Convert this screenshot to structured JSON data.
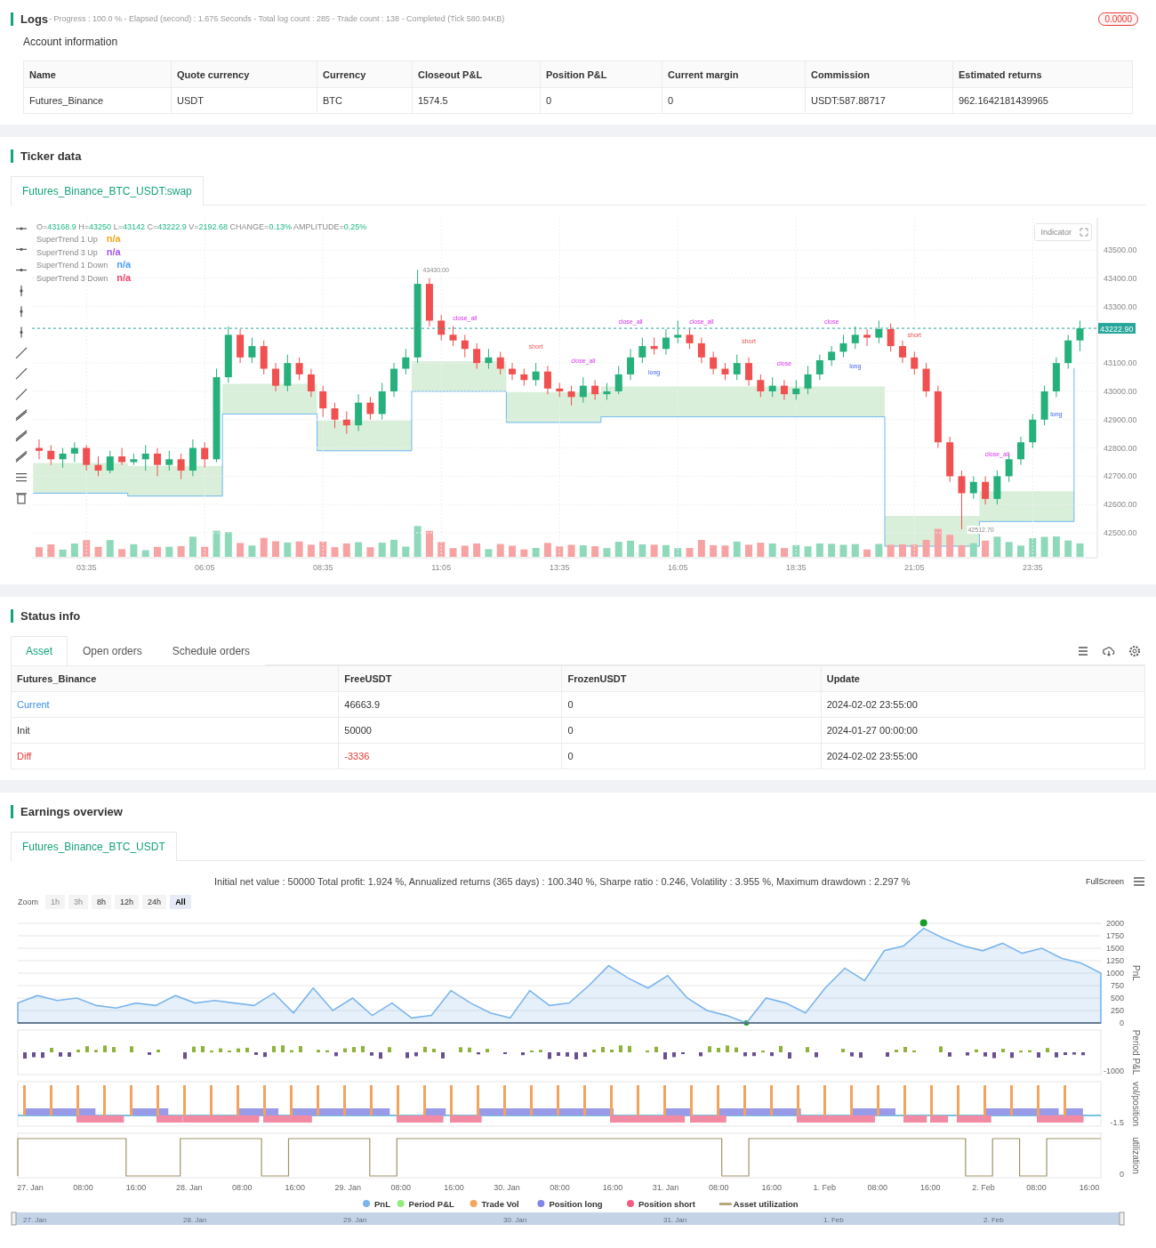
{
  "logs": {
    "title": "Logs",
    "summary": "- Progress : 100.0 % - Elapsed (second) : 1.676  Seconds - Total log count : 285 - Trade count : 138 - Completed (Tick 580.94KB)",
    "badge": "0.0000"
  },
  "account": {
    "title": "Account information",
    "columns": [
      "Name",
      "Quote currency",
      "Currency",
      "Closeout P&L",
      "Position P&L",
      "Current margin",
      "Commission",
      "Estimated returns"
    ],
    "rows": [
      [
        "Futures_Binance",
        "USDT",
        "BTC",
        "1574.5",
        "0",
        "0",
        "USDT:587.88717",
        "962.1642181439965"
      ]
    ]
  },
  "ticker": {
    "title": "Ticker data",
    "tabs": [
      {
        "label": "Futures_Binance_BTC_USDT:swap",
        "selected": true
      }
    ],
    "chart": {
      "ohlc": [
        {
          "label": "O=",
          "value": "43168.9"
        },
        {
          "label": "H=",
          "value": "43250"
        },
        {
          "label": "L=",
          "value": "43142"
        },
        {
          "label": "C=",
          "value": "43222.9"
        },
        {
          "label": "V=",
          "value": "2192.68"
        },
        {
          "label": "CHANGE=",
          "value": "0.13%"
        },
        {
          "label": "AMPLITUDE=",
          "value": "0.25%"
        }
      ],
      "legend": [
        {
          "name": "SuperTrend 1 Up",
          "value": "n/a",
          "color": "#f5a623"
        },
        {
          "name": "SuperTrend 3 Up",
          "value": "n/a",
          "color": "#a259e6"
        },
        {
          "name": "SuperTrend 1 Down",
          "value": "n/a",
          "color": "#4a9ff5"
        },
        {
          "name": "SuperTrend 3 Down",
          "value": "n/a",
          "color": "#f0436a"
        }
      ],
      "indicator_button": "Indicator",
      "current_price": "43222.90",
      "high_label": "43430.00",
      "low_label": "42512.70",
      "markers": [
        {
          "text": "close_all",
          "kind": "close"
        },
        {
          "text": "short",
          "kind": "short"
        },
        {
          "text": "close_all",
          "kind": "close"
        },
        {
          "text": "close_all",
          "kind": "close"
        },
        {
          "text": "long",
          "kind": "long"
        },
        {
          "text": "close_all",
          "kind": "close"
        },
        {
          "text": "short",
          "kind": "short"
        },
        {
          "text": "close",
          "kind": "close"
        },
        {
          "text": "close",
          "kind": "close"
        },
        {
          "text": "long",
          "kind": "long"
        },
        {
          "text": "short",
          "kind": "short"
        },
        {
          "text": "close_all",
          "kind": "close"
        },
        {
          "text": "long",
          "kind": "long"
        }
      ],
      "chart_data": {
        "type": "candlestick",
        "grid": true,
        "ylim": [
          42412,
          43613
        ],
        "yticks": [
          {
            "value": 43500,
            "label": "43500.00"
          },
          {
            "value": 43400,
            "label": "43400.00"
          },
          {
            "value": 43300,
            "label": "43300.00"
          },
          {
            "value": 43100,
            "label": "43100.00"
          },
          {
            "value": 43000,
            "label": "43000.00"
          },
          {
            "value": 42900,
            "label": "42900.00"
          },
          {
            "value": 42800,
            "label": "42800.00"
          },
          {
            "value": 42700,
            "label": "42700.00"
          },
          {
            "value": 42600,
            "label": "42600.00"
          },
          {
            "value": 42500,
            "label": "42500.00"
          }
        ],
        "xlim": [
          146,
          1497
        ],
        "xticks": [
          {
            "value": 215,
            "label": "03:35"
          },
          {
            "value": 365,
            "label": "06:05"
          },
          {
            "value": 515,
            "label": "08:35"
          },
          {
            "value": 665,
            "label": "11:05"
          },
          {
            "value": 815,
            "label": "13:35"
          },
          {
            "value": 965,
            "label": "16:05"
          },
          {
            "value": 1115,
            "label": "18:35"
          },
          {
            "value": 1265,
            "label": "21:05"
          },
          {
            "value": 1415,
            "label": "23:35"
          }
        ],
        "x": [
          155,
          170,
          185,
          200,
          215,
          230,
          245,
          260,
          275,
          290,
          305,
          320,
          335,
          350,
          365,
          380,
          395,
          410,
          425,
          440,
          455,
          470,
          485,
          500,
          515,
          530,
          545,
          560,
          575,
          590,
          605,
          620,
          635,
          650,
          665,
          680,
          695,
          710,
          725,
          740,
          755,
          770,
          785,
          800,
          815,
          830,
          845,
          860,
          875,
          890,
          905,
          920,
          935,
          950,
          965,
          980,
          995,
          1010,
          1025,
          1040,
          1055,
          1070,
          1085,
          1100,
          1115,
          1130,
          1145,
          1160,
          1175,
          1190,
          1205,
          1220,
          1235,
          1250,
          1265,
          1280,
          1295,
          1310,
          1325,
          1340,
          1355,
          1370,
          1385,
          1400,
          1415,
          1430,
          1445,
          1460,
          1475
        ],
        "ohlc": [
          [
            42800,
            42830,
            42760,
            42790
          ],
          [
            42790,
            42810,
            42740,
            42760
          ],
          [
            42760,
            42800,
            42730,
            42780
          ],
          [
            42780,
            42820,
            42750,
            42800
          ],
          [
            42800,
            42810,
            42720,
            42740
          ],
          [
            42740,
            42770,
            42700,
            42720
          ],
          [
            42720,
            42790,
            42710,
            42770
          ],
          [
            42770,
            42800,
            42740,
            42750
          ],
          [
            42750,
            42780,
            42740,
            42760
          ],
          [
            42760,
            42810,
            42720,
            42780
          ],
          [
            42780,
            42800,
            42700,
            42740
          ],
          [
            42740,
            42790,
            42720,
            42760
          ],
          [
            42760,
            42780,
            42690,
            42720
          ],
          [
            42720,
            42830,
            42700,
            42800
          ],
          [
            42800,
            42820,
            42730,
            42760
          ],
          [
            42760,
            43080,
            42750,
            43050
          ],
          [
            43050,
            43230,
            43030,
            43200
          ],
          [
            43200,
            43220,
            43100,
            43120
          ],
          [
            43120,
            43190,
            43100,
            43160
          ],
          [
            43160,
            43180,
            43060,
            43080
          ],
          [
            43080,
            43100,
            43000,
            43020
          ],
          [
            43020,
            43130,
            43000,
            43100
          ],
          [
            43100,
            43120,
            43040,
            43060
          ],
          [
            43060,
            43080,
            42980,
            43000
          ],
          [
            43000,
            43020,
            42910,
            42940
          ],
          [
            42940,
            42960,
            42870,
            42900
          ],
          [
            42900,
            42930,
            42850,
            42880
          ],
          [
            42880,
            42990,
            42860,
            42960
          ],
          [
            42960,
            42980,
            42900,
            42920
          ],
          [
            42920,
            43030,
            42900,
            43000
          ],
          [
            43000,
            43100,
            42980,
            43080
          ],
          [
            43080,
            43150,
            43060,
            43120
          ],
          [
            43120,
            43430,
            43100,
            43380
          ],
          [
            43380,
            43400,
            43230,
            43250
          ],
          [
            43250,
            43270,
            43180,
            43200
          ],
          [
            43200,
            43230,
            43160,
            43180
          ],
          [
            43180,
            43200,
            43120,
            43150
          ],
          [
            43150,
            43170,
            43080,
            43100
          ],
          [
            43100,
            43150,
            43080,
            43120
          ],
          [
            43120,
            43140,
            43060,
            43080
          ],
          [
            43080,
            43100,
            43040,
            43060
          ],
          [
            43060,
            43080,
            43020,
            43040
          ],
          [
            43040,
            43100,
            43020,
            43070
          ],
          [
            43070,
            43090,
            42990,
            43010
          ],
          [
            43010,
            43030,
            42980,
            43000
          ],
          [
            43000,
            43020,
            42950,
            42980
          ],
          [
            42980,
            43050,
            42960,
            43020
          ],
          [
            43020,
            43040,
            42970,
            42990
          ],
          [
            42990,
            43030,
            42970,
            43000
          ],
          [
            43000,
            43090,
            42990,
            43060
          ],
          [
            43060,
            43150,
            43040,
            43120
          ],
          [
            43120,
            43190,
            43100,
            43160
          ],
          [
            43160,
            43190,
            43130,
            43150
          ],
          [
            43150,
            43220,
            43130,
            43190
          ],
          [
            43190,
            43250,
            43170,
            43200
          ],
          [
            43200,
            43220,
            43150,
            43170
          ],
          [
            43170,
            43190,
            43100,
            43120
          ],
          [
            43120,
            43140,
            43060,
            43080
          ],
          [
            43080,
            43100,
            43040,
            43060
          ],
          [
            43060,
            43130,
            43040,
            43100
          ],
          [
            43100,
            43120,
            43020,
            43040
          ],
          [
            43040,
            43060,
            42980,
            43000
          ],
          [
            43000,
            43050,
            42980,
            43020
          ],
          [
            43020,
            43040,
            42970,
            42990
          ],
          [
            42990,
            43040,
            42970,
            43010
          ],
          [
            43010,
            43090,
            42990,
            43060
          ],
          [
            43060,
            43130,
            43040,
            43110
          ],
          [
            43110,
            43160,
            43090,
            43140
          ],
          [
            43140,
            43200,
            43120,
            43170
          ],
          [
            43170,
            43230,
            43150,
            43200
          ],
          [
            43200,
            43220,
            43160,
            43190
          ],
          [
            43190,
            43250,
            43170,
            43220
          ],
          [
            43220,
            43240,
            43140,
            43160
          ],
          [
            43160,
            43180,
            43100,
            43120
          ],
          [
            43120,
            43140,
            43060,
            43080
          ],
          [
            43080,
            43100,
            42980,
            43000
          ],
          [
            43000,
            43020,
            42800,
            42820
          ],
          [
            42820,
            42840,
            42680,
            42700
          ],
          [
            42700,
            42720,
            42512.7,
            42640
          ],
          [
            42640,
            42700,
            42620,
            42680
          ],
          [
            42680,
            42700,
            42600,
            42620
          ],
          [
            42620,
            42720,
            42600,
            42700
          ],
          [
            42700,
            42780,
            42680,
            42760
          ],
          [
            42760,
            42840,
            42740,
            42820
          ],
          [
            42820,
            42920,
            42800,
            42900
          ],
          [
            42900,
            43020,
            42880,
            43000
          ],
          [
            43000,
            43120,
            42980,
            43100
          ],
          [
            43100,
            43200,
            43080,
            43180
          ],
          [
            43180,
            43250,
            43142,
            43222.9
          ]
        ]
      }
    }
  },
  "status": {
    "title": "Status info",
    "tabs": [
      {
        "label": "Asset",
        "selected": true
      },
      {
        "label": "Open orders",
        "selected": false
      },
      {
        "label": "Schedule orders",
        "selected": false
      }
    ],
    "columns": [
      "Futures_Binance",
      "FreeUSDT",
      "FrozenUSDT",
      "Update"
    ],
    "rows": [
      {
        "kind": "current",
        "cells": [
          "Current",
          "46663.9",
          "0",
          "2024-02-02 23:55:00"
        ]
      },
      {
        "kind": "init",
        "cells": [
          "Init",
          "50000",
          "0",
          "2024-01-27 00:00:00"
        ]
      },
      {
        "kind": "diff",
        "cells": [
          "Diff",
          "-3336",
          "0",
          "2024-02-02 23:55:00"
        ]
      }
    ]
  },
  "earnings": {
    "title": "Earnings overview",
    "tabs": [
      {
        "label": "Futures_Binance_BTC_USDT",
        "selected": true
      }
    ],
    "summary": "Initial net value : 50000 Total profit: 1.924 %, Annualized returns (365 days) : 100.340 %, Sharpe ratio : 0.246, Volatility : 3.955 %, Maximum drawdown : 2.297 %",
    "fullscreen": "FullScreen",
    "zoom_label": "Zoom",
    "zoom": [
      {
        "label": "1h",
        "disabled": true,
        "selected": false
      },
      {
        "label": "3h",
        "disabled": true,
        "selected": false
      },
      {
        "label": "8h",
        "disabled": false,
        "selected": false
      },
      {
        "label": "12h",
        "disabled": false,
        "selected": false
      },
      {
        "label": "24h",
        "disabled": false,
        "selected": false
      },
      {
        "label": "All",
        "disabled": false,
        "selected": true
      }
    ],
    "chart_data": {
      "type": "area",
      "grid": true,
      "ylabel": "PnL",
      "ylim": [
        0,
        2000
      ],
      "yticks": [
        0,
        250,
        500,
        750,
        1000,
        1250,
        1500,
        1750,
        2000
      ],
      "series": [
        {
          "name": "PnL",
          "color": "#7cb5ec",
          "values": [
            400,
            550,
            450,
            500,
            350,
            300,
            400,
            350,
            550,
            400,
            450,
            400,
            350,
            600,
            200,
            700,
            250,
            500,
            150,
            400,
            100,
            150,
            650,
            400,
            200,
            100,
            650,
            350,
            400,
            750,
            1150,
            900,
            700,
            950,
            500,
            250,
            150,
            0,
            500,
            400,
            200,
            700,
            1100,
            850,
            1450,
            1550,
            1900,
            1700,
            1550,
            1450,
            1600,
            1400,
            1500,
            1300,
            1200,
            1000
          ]
        }
      ]
    },
    "panels": [
      {
        "label": "Period P&L",
        "tick": "-1000"
      },
      {
        "label": "vol/position",
        "tick": "-1.5"
      },
      {
        "label": "utilization",
        "tick": "0"
      }
    ],
    "x_axis": [
      "27. Jan",
      "08:00",
      "16:00",
      "28. Jan",
      "08:00",
      "16:00",
      "29. Jan",
      "08:00",
      "16:00",
      "30. Jan",
      "08:00",
      "16:00",
      "31. Jan",
      "08:00",
      "16:00",
      "1. Feb",
      "08:00",
      "16:00",
      "2. Feb",
      "08:00",
      "16:00"
    ],
    "legend": [
      {
        "name": "Period P&L",
        "color": "#90ed7d",
        "kind": "dot"
      },
      {
        "name": "Trade Vol",
        "color": "#f7a35c",
        "kind": "dot"
      },
      {
        "name": "Position long",
        "color": "#8085e9",
        "kind": "dot"
      },
      {
        "name": "Position short",
        "color": "#f15c80",
        "kind": "dot"
      },
      {
        "name": "Asset utilization",
        "color": "#b5a97a",
        "kind": "line"
      }
    ],
    "navigator": [
      "27. Jan",
      "28. Jan",
      "29. Jan",
      "30. Jan",
      "31. Jan",
      "1. Feb",
      "2. Feb"
    ]
  }
}
